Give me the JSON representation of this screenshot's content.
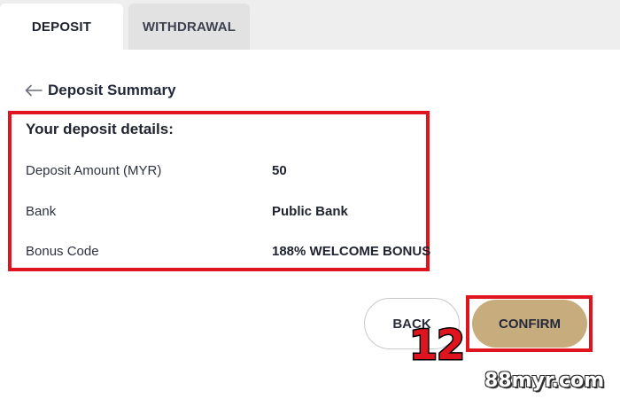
{
  "tabs": [
    {
      "label": "DEPOSIT",
      "active": true
    },
    {
      "label": "WITHDRAWAL",
      "active": false
    }
  ],
  "summary": {
    "title": "Deposit Summary",
    "back_icon": "arrow-left-icon"
  },
  "details": {
    "heading": "Your deposit details:",
    "rows": [
      {
        "label": "Deposit Amount (MYR)",
        "value": "50"
      },
      {
        "label": "Bank",
        "value": "Public Bank"
      },
      {
        "label": "Bonus Code",
        "value": "188% WELCOME BONUS"
      }
    ]
  },
  "actions": {
    "back_label": "BACK",
    "confirm_label": "CONFIRM"
  },
  "annotation": {
    "step": "12",
    "highlight_color": "#e0141e"
  },
  "watermark": "88myr.com",
  "colors": {
    "confirm_bg": "#c7ad7d",
    "tab_bar_bg": "#eeeeee"
  }
}
